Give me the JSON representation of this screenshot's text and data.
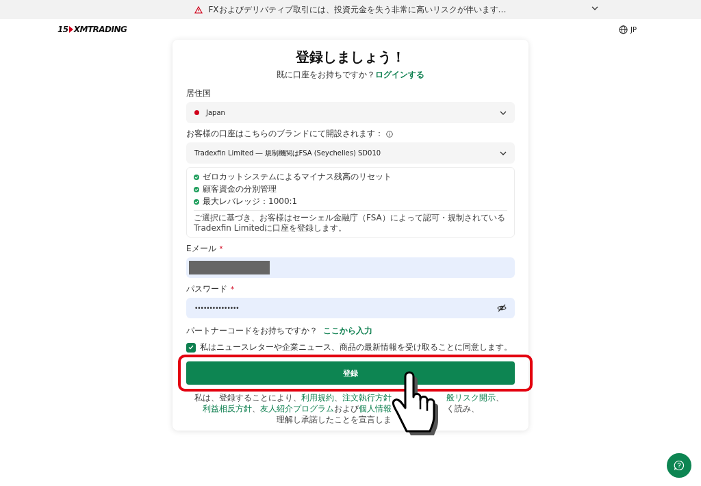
{
  "banner": {
    "text": "FXおよびデリバティブ取引には、投資元金を失う非常に高いリスクが伴います…",
    "expanded": false
  },
  "header": {
    "logo_years": "15",
    "logo_text": "XMTRADING",
    "language": "JP"
  },
  "form": {
    "title": "登録しましょう！",
    "login_prompt": "既に口座をお持ちですか？",
    "login_link": "ログインする",
    "country": {
      "label": "居住国",
      "value": "Japan"
    },
    "brand": {
      "label": "お客様の口座はこちらのブランドにて開設されます：",
      "value": "Tradexfin Limited ― 規制機関はFSA (Seychelles) SD010"
    },
    "features": [
      "ゼロカットシステムによるマイナス残高のリセット",
      "顧客資金の分別管理",
      "最大レバレッジ：1000:1"
    ],
    "brand_note": "ご選択に基づき、お客様はセーシェル金融庁（FSA）によって認可・規制されているTradexfin Limitedに口座を登録します。",
    "email": {
      "label": "Eメール",
      "required_mark": "*",
      "value_redacted": true
    },
    "password": {
      "label": "パスワード",
      "required_mark": "*",
      "value": "•••••••••••••••"
    },
    "partner_prompt": "パートナーコードをお持ちですか？",
    "partner_link": "ここから入力",
    "newsletter": {
      "label": "私はニュースレターや企業ニュース、商品の最新情報を受け取ることに同意します。",
      "checked": true
    },
    "submit": {
      "label": "登録",
      "highlighted": true
    },
    "footer_lines": [
      {
        "before": [
          {
            "text": "私は、登録することにより、",
            "kind": "text"
          },
          {
            "text": "利用規約",
            "kind": "link"
          },
          {
            "text": "、",
            "kind": "text"
          },
          {
            "text": "注文執行方針",
            "kind": "link"
          }
        ],
        "after": [
          {
            "text": "般リスク開示",
            "kind": "link"
          },
          {
            "text": "、",
            "kind": "text"
          }
        ]
      },
      {
        "before": [
          {
            "text": "利益相反方針",
            "kind": "link"
          },
          {
            "text": "、",
            "kind": "text"
          },
          {
            "text": "友人紹介プログラム",
            "kind": "link"
          },
          {
            "text": "および",
            "kind": "text"
          },
          {
            "text": "個人情報",
            "kind": "link"
          }
        ],
        "after": [
          {
            "text": "く読み、",
            "kind": "text"
          }
        ]
      },
      {
        "before": [
          {
            "text": "理解し承諾したことを宣言しま",
            "kind": "text"
          }
        ]
      }
    ]
  },
  "pointer_cursor": true
}
